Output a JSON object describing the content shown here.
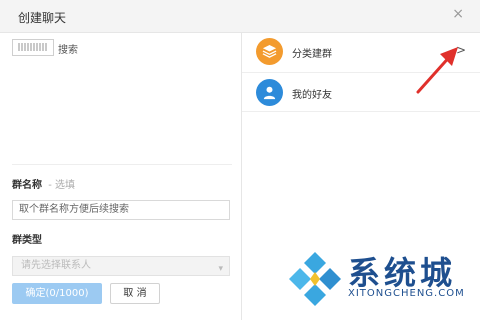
{
  "dialog": {
    "title": "创建聊天",
    "close_glyph": "×"
  },
  "left": {
    "search_label": "搜索",
    "group_name_label": "群名称",
    "group_name_optional": "- 选填",
    "group_name_placeholder": "取个群名称方便后续搜索",
    "group_type_label": "群类型",
    "group_type_placeholder": "请先选择联系人",
    "confirm_label": "确定(0/1000)",
    "cancel_label": "取 消"
  },
  "right": {
    "items": [
      {
        "label": "分类建群",
        "icon": "layers-icon",
        "color": "#f39b2e"
      },
      {
        "label": "我的好友",
        "icon": "user-icon",
        "color": "#2d8bda"
      }
    ],
    "chevron_glyph": ">"
  },
  "annotation": {
    "color": "#e0302b"
  },
  "watermark": {
    "text": "系统城",
    "url": "XITONGCHENG.COM"
  }
}
